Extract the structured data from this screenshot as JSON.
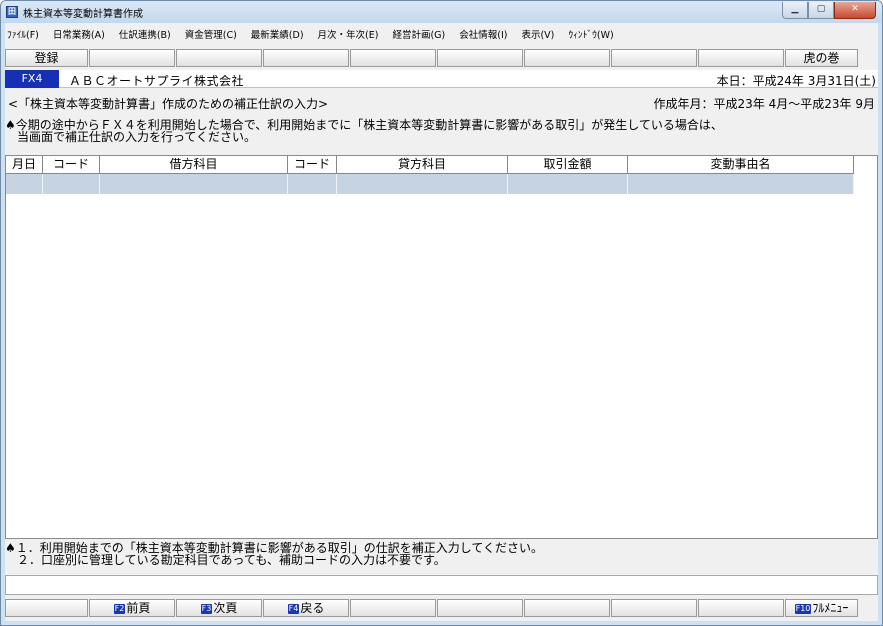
{
  "window": {
    "title": "株主資本等変動計算書作成",
    "icon": "app-icon",
    "buttons": [
      "minimize",
      "maximize",
      "close"
    ]
  },
  "menu": [
    "ﾌｧｲﾙ(F)",
    "日常業務(A)",
    "仕訳連携(B)",
    "資金管理(C)",
    "最新業績(D)",
    "月次・年次(E)",
    "経営計画(G)",
    "会社情報(I)",
    "表示(V)",
    "ｳｨﾝﾄﾞｳ(W)"
  ],
  "toolbar": {
    "keys": [
      {
        "label": "登録"
      },
      {
        "label": ""
      },
      {
        "label": ""
      },
      {
        "label": ""
      },
      {
        "label": ""
      },
      {
        "label": ""
      },
      {
        "label": ""
      },
      {
        "label": ""
      },
      {
        "label": ""
      },
      {
        "label": "虎の巻"
      }
    ]
  },
  "header": {
    "badge": "FX4",
    "company": "ＡＢＣオートサプライ株式会社",
    "today": "本日：平成24年 3月31日(土)",
    "subtitle": "<「株主資本等変動計算書」作成のための補正仕訳の入力>",
    "period": "作成年月：平成23年 4月～平成23年 9月"
  },
  "notice": {
    "line1": "♠今期の途中からＦＸ４を利用開始した場合で、利用開始までに「株主資本等変動計算書に影響がある取引」が発生している場合は、",
    "line2": "　当画面で補正仕訳の入力を行ってください。"
  },
  "table": {
    "columns": [
      "月日",
      "コード",
      "借方科目",
      "コード",
      "貸方科目",
      "取引金額",
      "変動事由名"
    ],
    "rows": [
      [
        "",
        "",
        "",
        "",
        "",
        "",
        ""
      ]
    ]
  },
  "footer_notes": {
    "line1": "♠１．利用開始までの「株主資本等変動計算書に影響がある取引」の仕訳を補正入力してください。",
    "line2": "　２．口座別に管理している勘定科目であっても、補助コードの入力は不要です。"
  },
  "bottom_keys": [
    {
      "badge": "",
      "label": ""
    },
    {
      "badge": "F2",
      "label": "前頁"
    },
    {
      "badge": "F3",
      "label": "次頁"
    },
    {
      "badge": "F4",
      "label": "戻る"
    },
    {
      "badge": "",
      "label": ""
    },
    {
      "badge": "",
      "label": ""
    },
    {
      "badge": "",
      "label": ""
    },
    {
      "badge": "",
      "label": ""
    },
    {
      "badge": "",
      "label": ""
    },
    {
      "badge": "F10",
      "label": "ﾌﾙﾒﾆｭｰ"
    }
  ],
  "colors": {
    "fx4_badge": "#1630b5",
    "key_badge": "#1a37b0",
    "selected_row": "#c5d3e2"
  }
}
